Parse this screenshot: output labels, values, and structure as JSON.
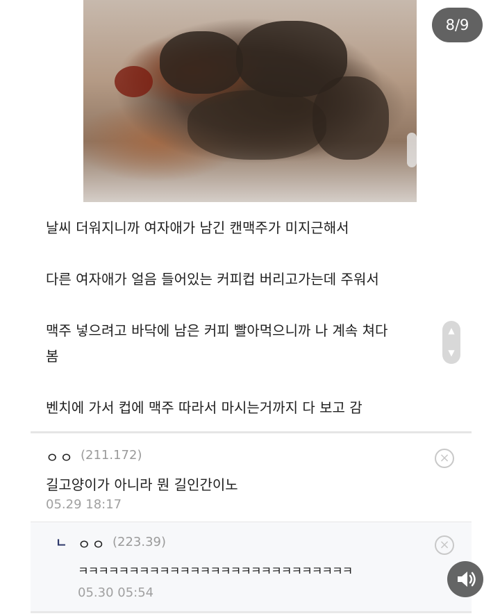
{
  "counter": "8/9",
  "post_lines": [
    "날씨 더워지니까 여자애가 남긴 캔맥주가 미지근해서",
    "다른 여자애가 얼음 들어있는 커피컵 버리고가는데 주워서",
    "맥주 넣으려고 바닥에 남은 커피 빨아먹으니까 나 계속 쳐다",
    "봄",
    "벤치에 가서 컵에 맥주 따라서 마시는거까지 다 보고 감"
  ],
  "comments": [
    {
      "author": "ㅇㅇ",
      "ip": "(211.172)",
      "text": "길고양이가 아니라 뭔 길인간이노",
      "time": "05.29 18:17"
    },
    {
      "reply_mark": "ㄴ",
      "author": "ㅇㅇ",
      "ip": "(223.39)",
      "text": "ㅋㅋㅋㅋㅋㅋㅋㅋㅋㅋㅋㅋㅋㅋㅋㅋㅋㅋㅋㅋㅋㅋㅋㅋㅋㅋㅋ",
      "time": "05.30 05:54"
    }
  ],
  "icons": {
    "close": "close-circle-icon",
    "sound": "speaker-icon",
    "scroll_up": "chevron-up-icon",
    "scroll_down": "chevron-down-icon"
  }
}
